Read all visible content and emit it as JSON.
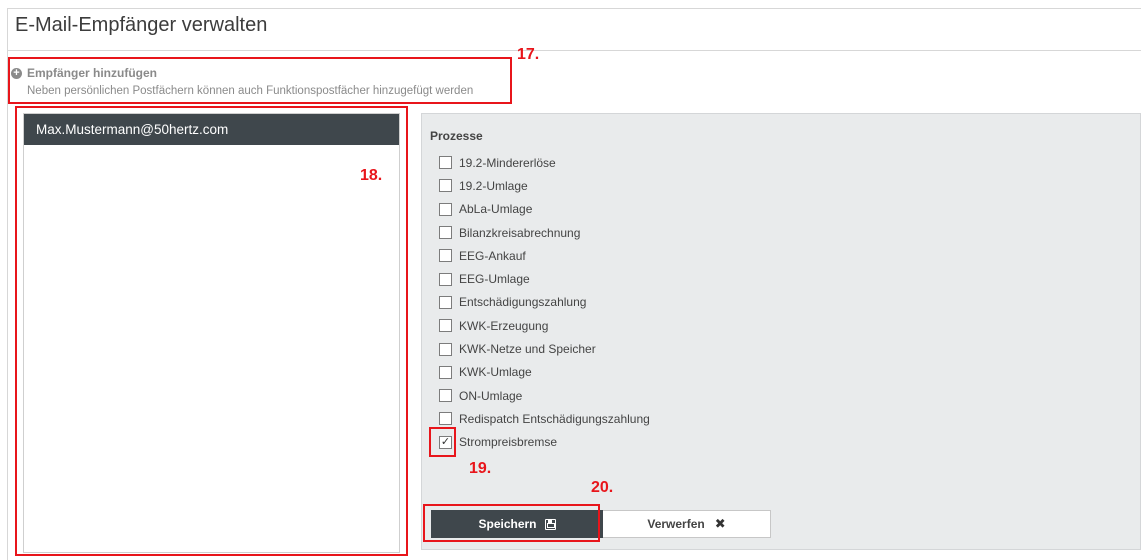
{
  "page": {
    "title": "E-Mail-Empfänger verwalten"
  },
  "add": {
    "label": "Empfänger hinzufügen",
    "hint": "Neben persönlichen Postfächern können auch Funktionspostfächer hinzugefügt werden",
    "icon": "plus-circle-icon"
  },
  "recipients": {
    "items": [
      {
        "email": "Max.Mustermann@50hertz.com",
        "selected": true
      }
    ]
  },
  "processes": {
    "heading": "Prozesse",
    "items": [
      {
        "label": "19.2-Mindererlöse",
        "checked": false,
        "mark": ""
      },
      {
        "label": "19.2-Umlage",
        "checked": false,
        "mark": ""
      },
      {
        "label": "AbLa-Umlage",
        "checked": false,
        "mark": ""
      },
      {
        "label": "Bilanzkreisabrechnung",
        "checked": false,
        "mark": ""
      },
      {
        "label": "EEG-Ankauf",
        "checked": false,
        "mark": ""
      },
      {
        "label": "EEG-Umlage",
        "checked": false,
        "mark": ""
      },
      {
        "label": "Entschädigungszahlung",
        "checked": false,
        "mark": ""
      },
      {
        "label": "KWK-Erzeugung",
        "checked": false,
        "mark": ""
      },
      {
        "label": "KWK-Netze und Speicher",
        "checked": false,
        "mark": ""
      },
      {
        "label": "KWK-Umlage",
        "checked": false,
        "mark": ""
      },
      {
        "label": "ON-Umlage",
        "checked": false,
        "mark": ""
      },
      {
        "label": "Redispatch Entschädigungszahlung",
        "checked": false,
        "mark": ""
      },
      {
        "label": "Strompreisbremse",
        "checked": true,
        "mark": "✓"
      }
    ]
  },
  "actions": {
    "save_label": "Speichern",
    "save_icon": "floppy-disk-icon",
    "discard_label": "Verwerfen",
    "discard_icon": "close-icon",
    "discard_glyph": "✖"
  },
  "annotations": {
    "a17": "17.",
    "a18": "18.",
    "a19": "19.",
    "a20": "20.",
    "color": "#e8151b"
  }
}
